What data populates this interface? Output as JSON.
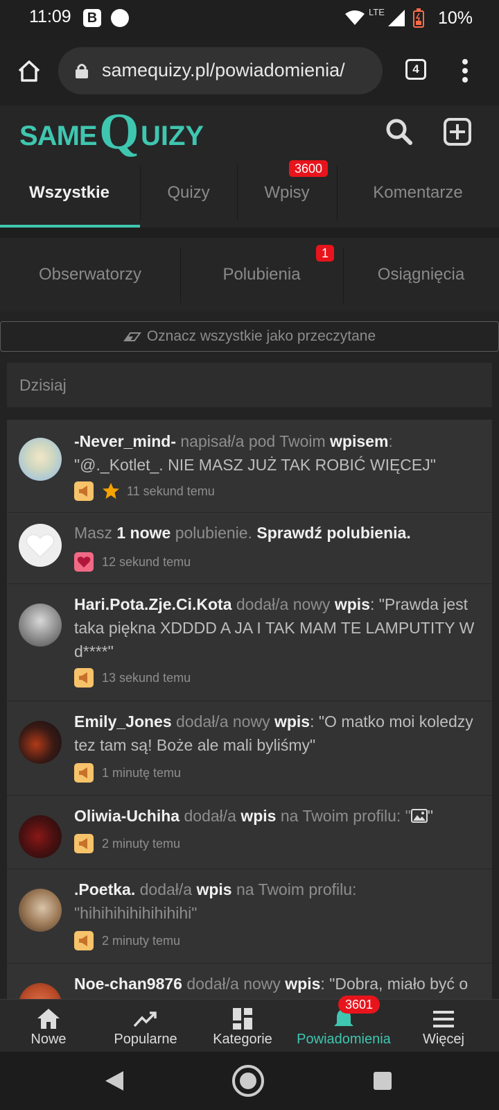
{
  "status": {
    "time": "11:09",
    "b_badge": "B",
    "network": "LTE",
    "battery": "10%"
  },
  "browser": {
    "url": "samequizy.pl/powiadomienia/",
    "tab_count": "4"
  },
  "site": {
    "logo_same": "SAME",
    "logo_quizy": "QUIZY"
  },
  "tabs_row1": [
    {
      "label": "Wszystkie",
      "active": true
    },
    {
      "label": "Quizy"
    },
    {
      "label": "Wpisy",
      "badge": "3600"
    },
    {
      "label": "Komentarze"
    }
  ],
  "tabs_row2": [
    {
      "label": "Obserwatorzy"
    },
    {
      "label": "Polubienia",
      "badge": "1"
    },
    {
      "label": "Osiągnięcia"
    }
  ],
  "mark_read": "Oznacz wszystkie jako przeczytane",
  "day_header": "Dzisiaj",
  "notifications": [
    {
      "user": "-Never_mind-",
      "action": " napisał/a pod Twoim ",
      "target": "wpisem",
      "sep": ":",
      "text": "\"@._Kotlet_. NIE MASZ JUŻ TAK ROBIĆ WIĘCEJ\"",
      "time": "11 sekund temu"
    },
    {
      "prefix": "Masz ",
      "count": "1 nowe",
      "action": " polubienie. ",
      "link": "Sprawdź polubienia.",
      "time": "12 sekund temu"
    },
    {
      "user": "Hari.Pota.Zje.Ci.Kota",
      "action": " dodał/a nowy ",
      "target": "wpis",
      "text": ": \"Prawda jest taka piękna XDDDD A JA I TAK MAM TE LAMPUTITY W d****\"",
      "time": "13 sekund temu"
    },
    {
      "user": "Emily_Jones",
      "action": " dodał/a nowy ",
      "target": "wpis",
      "text": ": \"O matko moi koledzy tez tam są! Boże ale mali byliśmy\"",
      "time": "1 minutę temu"
    },
    {
      "user": "Oliwia-Uchiha",
      "action": " dodał/a ",
      "target": "wpis",
      "text": " na Twoim profilu: \"",
      "text_end": "\"",
      "time": "2 minuty temu"
    },
    {
      "user": ".Poetka.",
      "action": " dodał/a ",
      "target": "wpis",
      "text": " na Twoim profilu: \"hihihihihihihihihi\"",
      "time": "2 minuty temu"
    },
    {
      "user": "Noe-chan9876",
      "action": " dodał/a nowy ",
      "target": "wpis",
      "text": ": \"Dobra, miało być o"
    }
  ],
  "bottom_nav": [
    {
      "label": "Nowe"
    },
    {
      "label": "Popularne"
    },
    {
      "label": "Kategorie"
    },
    {
      "label": "Powiadomienia",
      "badge": "3601",
      "active": true
    },
    {
      "label": "Więcej"
    }
  ],
  "colors": {
    "accent": "#3fc6b0",
    "badge": "#e8141c",
    "megaphone": "#f7c36a",
    "heart": "#f06a86",
    "star": "#f5a300"
  }
}
